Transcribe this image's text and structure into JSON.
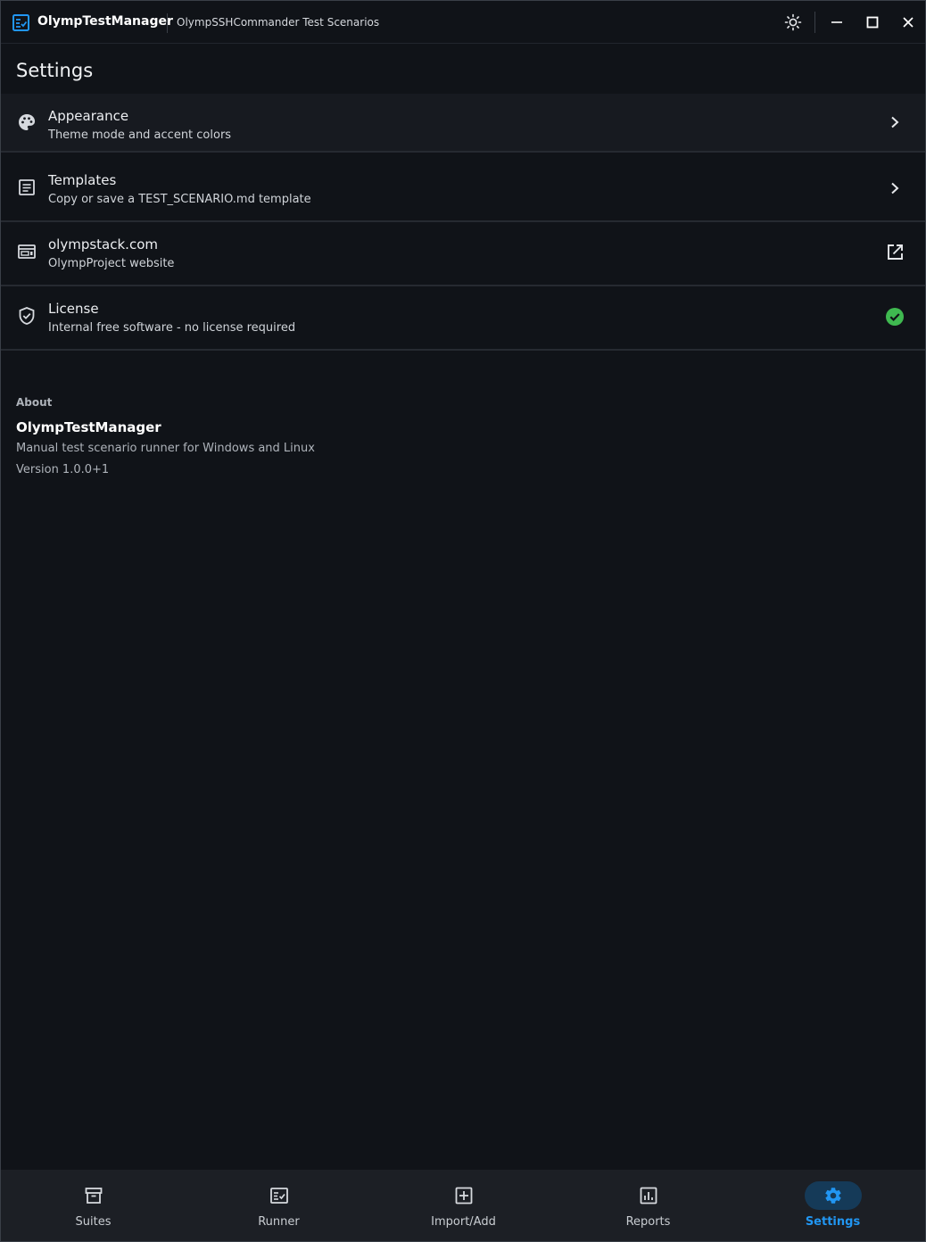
{
  "titlebar": {
    "app_name": "OlympTestManager",
    "project_name": "OlympSSHCommander Test Scenarios",
    "theme_icon": "sun-icon",
    "minimize_icon": "minimize-icon",
    "maximize_icon": "maximize-icon",
    "close_icon": "close-icon"
  },
  "page": {
    "title": "Settings"
  },
  "settings": {
    "items": [
      {
        "title": "Appearance",
        "subtitle": "Theme mode and accent colors",
        "icon": "palette-icon",
        "trailing": "chevron-right-icon"
      },
      {
        "title": "Templates",
        "subtitle": "Copy or save a TEST_SCENARIO.md template",
        "icon": "document-icon",
        "trailing": "chevron-right-icon"
      },
      {
        "title": "olympstack.com",
        "subtitle": "OlympProject website",
        "icon": "web-icon",
        "trailing": "open-external-icon"
      },
      {
        "title": "License",
        "subtitle": "Internal free software - no license required",
        "icon": "shield-check-icon",
        "trailing": "check-circle-icon"
      }
    ]
  },
  "about": {
    "label": "About",
    "name": "OlympTestManager",
    "description": "Manual test scenario runner for Windows and Linux",
    "version": "Version 1.0.0+1"
  },
  "nav": {
    "items": [
      {
        "label": "Suites",
        "icon": "archive-icon",
        "active": false
      },
      {
        "label": "Runner",
        "icon": "checklist-icon",
        "active": false
      },
      {
        "label": "Import/Add",
        "icon": "add-box-icon",
        "active": false
      },
      {
        "label": "Reports",
        "icon": "bar-chart-icon",
        "active": false
      },
      {
        "label": "Settings",
        "icon": "gear-icon",
        "active": true
      }
    ]
  },
  "colors": {
    "accent": "#2196f3",
    "success": "#3fb950",
    "background": "#101318"
  }
}
